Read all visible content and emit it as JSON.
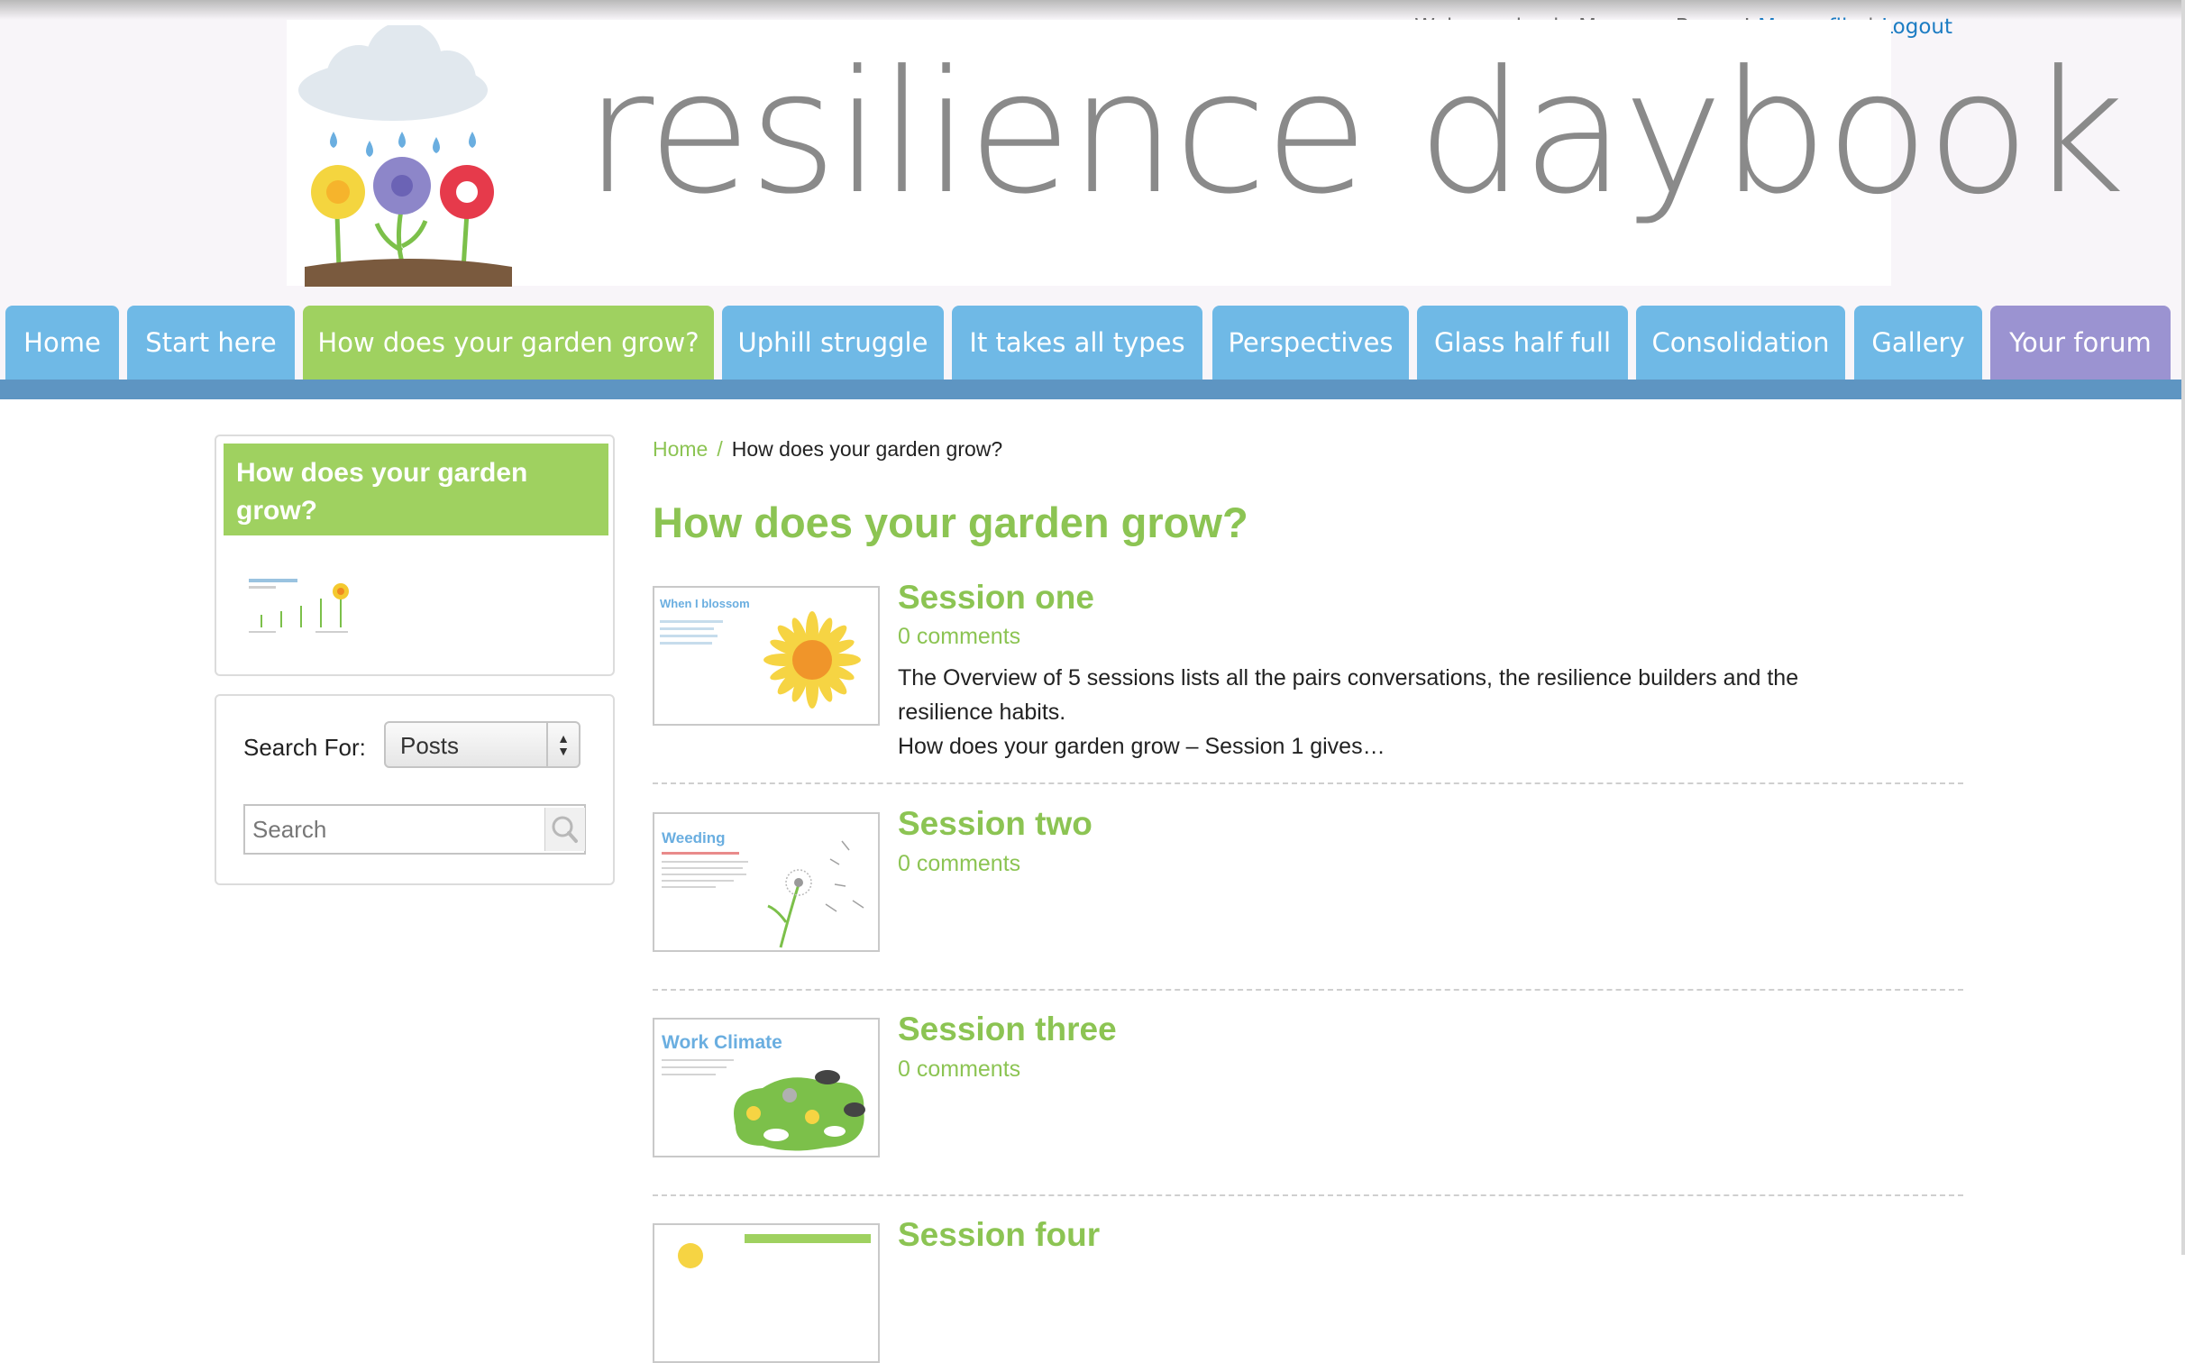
{
  "header": {
    "welcome_text": "Welcome back, Maureen Bowes!",
    "profile_link": "My profile",
    "separator": "|",
    "logout_link": "Logout"
  },
  "logo": {
    "text": "resilience daybook"
  },
  "nav": {
    "tabs": [
      {
        "label": "Home"
      },
      {
        "label": "Start here"
      },
      {
        "label": "How does your garden grow?"
      },
      {
        "label": "Uphill struggle"
      },
      {
        "label": "It takes all types"
      },
      {
        "label": "Perspectives"
      },
      {
        "label": "Glass half full"
      },
      {
        "label": "Consolidation"
      },
      {
        "label": "Gallery"
      },
      {
        "label": "Your forum"
      }
    ],
    "active_tab": "How does your garden grow?"
  },
  "sidebar": {
    "section_title": "How does your garden grow?",
    "search": {
      "label": "Search For:",
      "select_value": "Posts",
      "input_placeholder": "Search"
    }
  },
  "breadcrumb": {
    "home": "Home",
    "separator": "/",
    "current": "How does your garden grow?"
  },
  "main": {
    "title": "How does your garden grow?",
    "sessions": [
      {
        "title": "Session one",
        "comments": "0 comments",
        "thumb_title": "When I blossom",
        "excerpt_line1": "The Overview of 5 sessions lists all the pairs conversations, the resilience builders and the resilience habits.",
        "excerpt_line2": "How does your garden grow – Session 1 gives…"
      },
      {
        "title": "Session two",
        "comments": "0 comments",
        "thumb_title": "Weeding"
      },
      {
        "title": "Session three",
        "comments": "0 comments",
        "thumb_title": "Work Climate"
      },
      {
        "title": "Session four"
      }
    ]
  },
  "colors": {
    "tab_blue": "#6fb9e6",
    "tab_green": "#9fd160",
    "tab_purple": "#9b93d1",
    "nav_bar": "#5e95c2",
    "heading_green": "#8cc453",
    "link_blue": "#1c7cc3"
  },
  "icons": [
    "rain-cloud-icon",
    "flower-icon",
    "search-icon",
    "select-arrows-icon",
    "sunflower-icon",
    "dandelion-icon",
    "weather-icon"
  ]
}
